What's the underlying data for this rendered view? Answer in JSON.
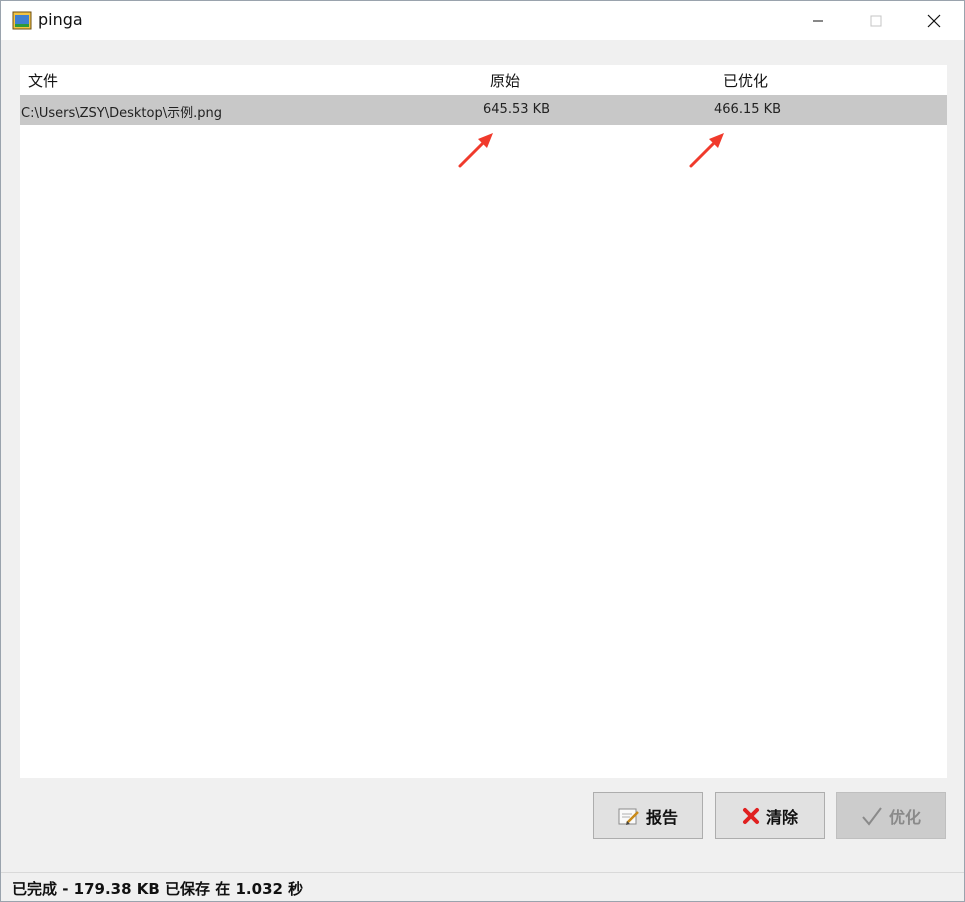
{
  "window": {
    "title": "pinga"
  },
  "list": {
    "columns": {
      "file": "文件",
      "original": "原始",
      "optimized": "已优化"
    },
    "rows": [
      {
        "file": "C:\\Users\\ZSY\\Desktop\\示例.png",
        "original": "645.53 KB",
        "optimized": "466.15 KB"
      }
    ]
  },
  "buttons": {
    "report": "报告",
    "clear": "清除",
    "optimize": "优化"
  },
  "status": {
    "text": "已完成 -  179.38 KB 已保存 在 1.032 秒"
  },
  "colors": {
    "annotation_arrow": "#f03a2c",
    "selected_row": "#c8c8c8",
    "clear_icon": "#e02020"
  }
}
